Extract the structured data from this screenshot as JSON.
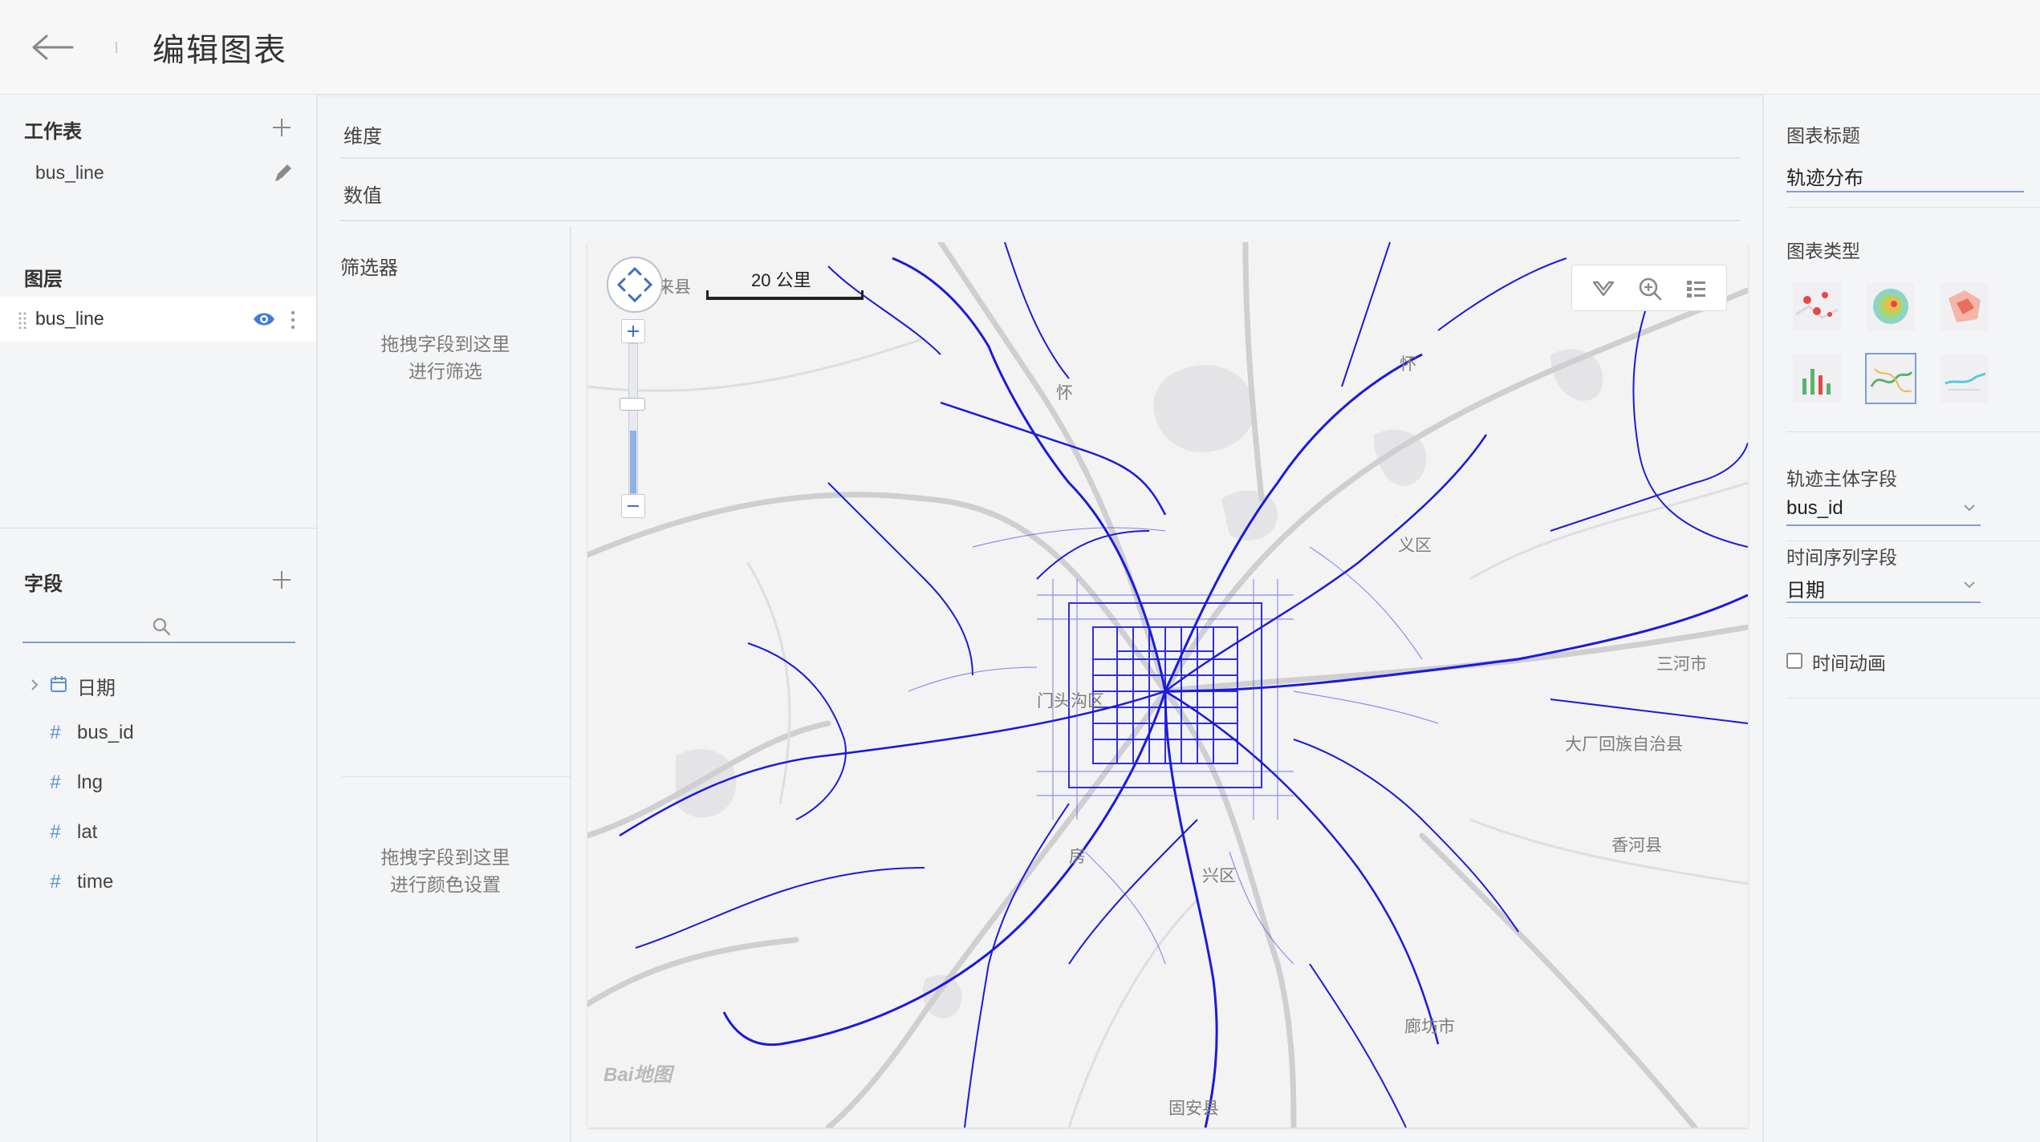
{
  "header": {
    "title": "编辑图表"
  },
  "left_sidebar": {
    "worksheet_heading": "工作表",
    "worksheet_name": "bus_line",
    "layer_heading": "图层",
    "layer_name": "bus_line",
    "fields_heading": "字段",
    "fields": [
      {
        "type": "date",
        "name": "日期"
      },
      {
        "type": "number",
        "name": "bus_id"
      },
      {
        "type": "number",
        "name": "lng"
      },
      {
        "type": "number",
        "name": "lat"
      },
      {
        "type": "number",
        "name": "time"
      }
    ]
  },
  "shelves": {
    "dimensions_label": "维度",
    "values_label": "数值",
    "filter_label": "筛选器",
    "filter_hint_1": "拖拽字段到这里",
    "filter_hint_2": "进行筛选",
    "color_hint_1": "拖拽字段到这里",
    "color_hint_2": "进行颜色设置"
  },
  "map": {
    "scale_label": "20 公里",
    "logo_text": "Bai地图",
    "line_color": "#1a1adf",
    "place_labels": [
      {
        "text": "怀来县"
      },
      {
        "text": "怀"
      },
      {
        "text": "义区"
      },
      {
        "text": "门头沟区"
      },
      {
        "text": "三河市"
      },
      {
        "text": "大厂回族自治县"
      },
      {
        "text": "香河县"
      },
      {
        "text": "房"
      },
      {
        "text": "兴区"
      },
      {
        "text": "廊坊市"
      },
      {
        "text": "固安县"
      }
    ]
  },
  "right_panel": {
    "chart_title_label": "图表标题",
    "chart_title_value": "轨迹分布",
    "chart_type_label": "图表类型",
    "chart_types": [
      "点图",
      "热力图",
      "区域图",
      "柱状图",
      "轨迹图",
      "线图"
    ],
    "selected_chart_type_index": 4,
    "subject_field_label": "轨迹主体字段",
    "subject_field_value": "bus_id",
    "time_field_label": "时间序列字段",
    "time_field_value": "日期",
    "animation_label": "时间动画",
    "animation_checked": false,
    "accent_color": "#7a9fd4"
  }
}
